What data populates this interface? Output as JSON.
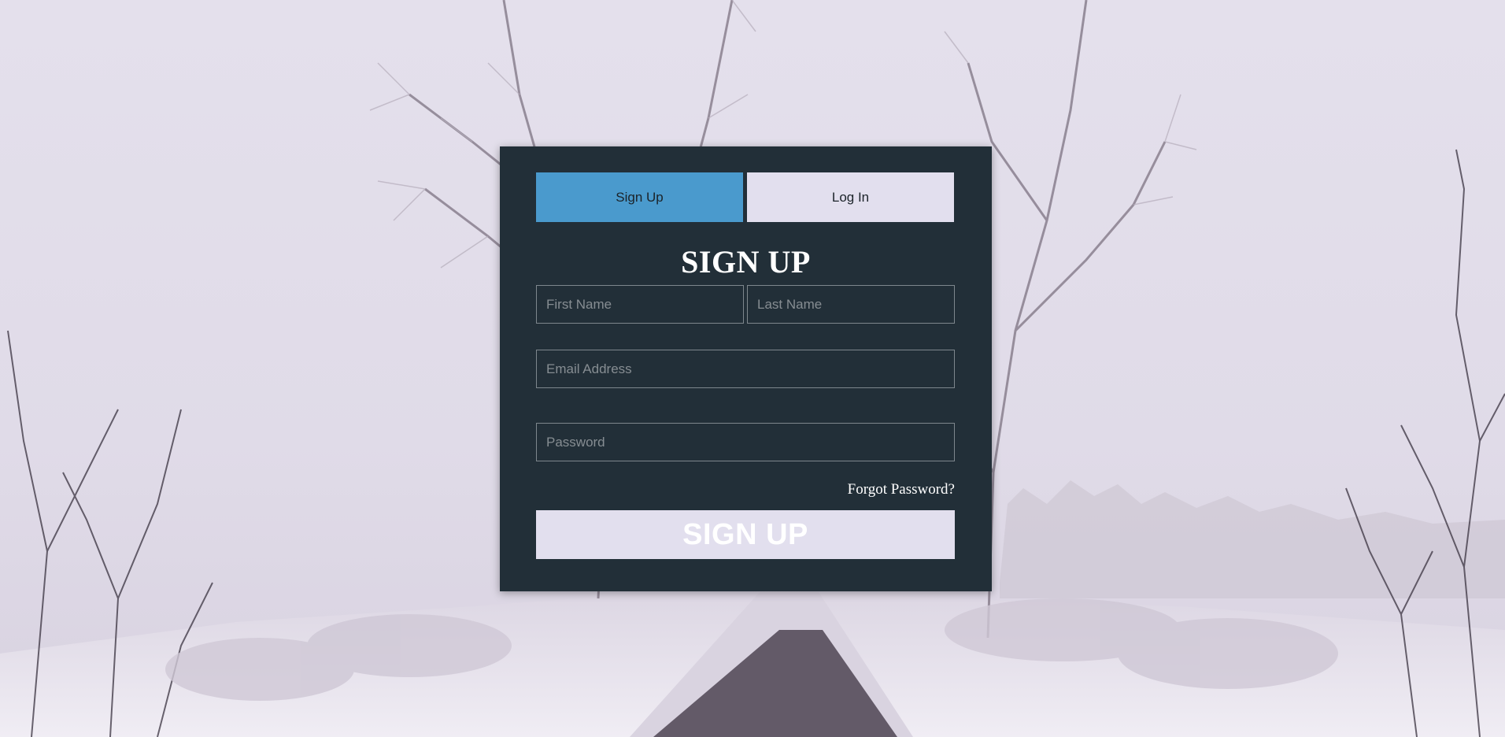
{
  "tabs": {
    "signup_label": "Sign Up",
    "login_label": "Log In",
    "active": "signup"
  },
  "form": {
    "title": "SIGN UP",
    "first_name_placeholder": "First Name",
    "last_name_placeholder": "Last Name",
    "email_placeholder": "Email Address",
    "password_placeholder": "Password",
    "forgot_label": "Forgot Password?",
    "submit_label": "SIGN UP"
  },
  "colors": {
    "card_bg": "#222f38",
    "tab_active": "#4a9acd",
    "tab_inactive": "#e2dfee",
    "field_border": "#7e878d",
    "sky": "#e2dde9",
    "road": "#4d4452"
  }
}
